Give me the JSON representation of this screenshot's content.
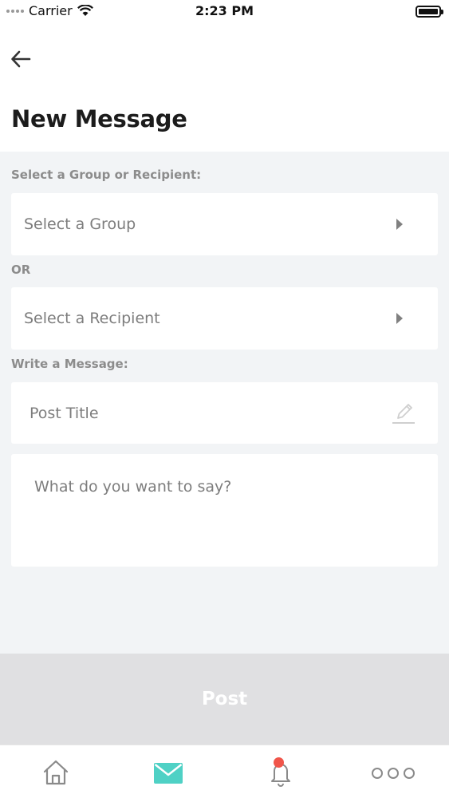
{
  "status_bar": {
    "carrier": "Carrier",
    "time": "2:23 PM",
    "icons": [
      "signal-icon",
      "wifi-icon",
      "battery-icon"
    ]
  },
  "header": {
    "back_icon": "arrow-left-icon",
    "title": "New Message"
  },
  "recipient_section": {
    "label": "Select a Group or Recipient:",
    "group_select": "Select a Group",
    "or_label": "OR",
    "recipient_select": "Select a Recipient"
  },
  "message_section": {
    "label": "Write a Message:",
    "title_placeholder": "Post Title",
    "body_placeholder": "What do you want to say?"
  },
  "actions": {
    "post_label": "Post"
  },
  "tab_bar": {
    "tabs": [
      "home-icon",
      "mail-icon",
      "bell-icon",
      "more-icon"
    ],
    "active": "mail-icon"
  },
  "colors": {
    "accent": "#4fd1c5",
    "notification": "#f0554a",
    "post_disabled_bg": "#e0e0e2"
  }
}
